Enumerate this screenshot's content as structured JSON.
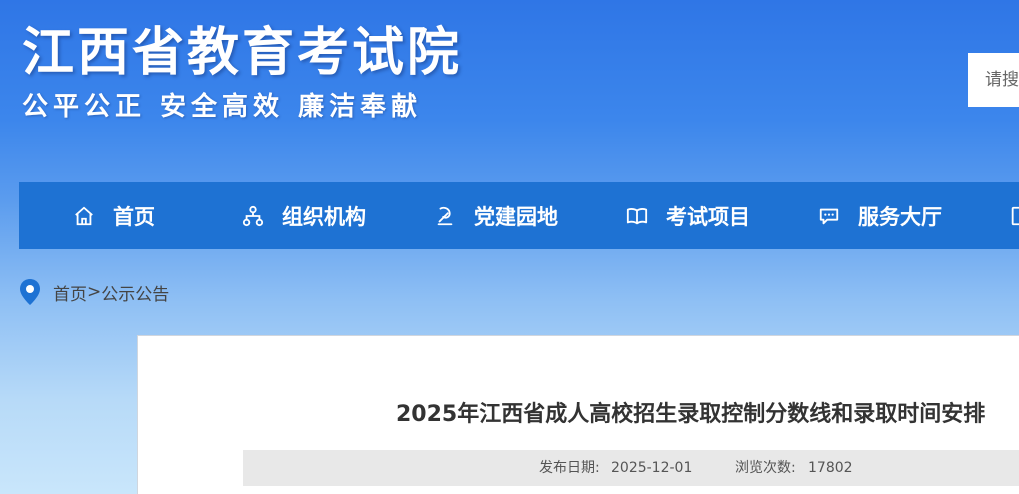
{
  "header": {
    "site_title": "江西省教育考试院",
    "slogan": "公平公正 安全高效 廉洁奉献",
    "search_placeholder": "请搜索"
  },
  "nav": {
    "items": [
      {
        "label": "首页",
        "icon": "home-icon"
      },
      {
        "label": "组织机构",
        "icon": "org-chart-icon"
      },
      {
        "label": "党建园地",
        "icon": "party-emblem-icon"
      },
      {
        "label": "考试项目",
        "icon": "book-icon"
      },
      {
        "label": "服务大厅",
        "icon": "chat-service-icon"
      }
    ]
  },
  "breadcrumb": {
    "icon": "location-pin-icon",
    "home": "首页",
    "separator": ">",
    "current": "公示公告"
  },
  "article": {
    "title": "2025年江西省成人高校招生录取控制分数线和录取时间安排",
    "publish_label": "发布日期:",
    "publish_date": "2025-12-01",
    "views_label": "浏览次数:",
    "views_count": "17802"
  },
  "colors": {
    "nav_background": "#1e72d3",
    "header_top": "#2f76e6",
    "page_bottom": "#c9e6fb",
    "location_pin": "#1e72d3"
  }
}
